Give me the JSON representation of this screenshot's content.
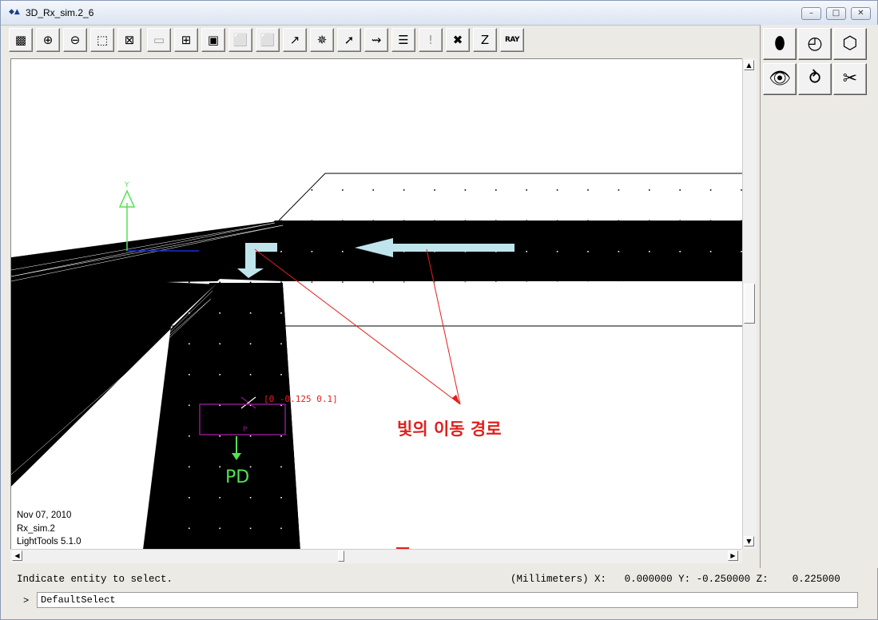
{
  "window": {
    "title": "3D_Rx_sim.2_6",
    "app_icon_text": "◆▲"
  },
  "window_controls": {
    "minimize": "–",
    "maximize": "□",
    "close": "✕"
  },
  "toolbar": {
    "buttons": [
      {
        "name": "zoom-fit-icon",
        "glyph": "▩"
      },
      {
        "name": "zoom-in-icon",
        "glyph": "⊕"
      },
      {
        "name": "zoom-out-icon",
        "glyph": "⊖"
      },
      {
        "name": "zoom-window-icon",
        "glyph": "⬚"
      },
      {
        "name": "zoom-extents-icon",
        "glyph": "⊠"
      },
      {
        "name": "blank-view-icon",
        "glyph": "▭"
      },
      {
        "name": "four-view-icon",
        "glyph": "⊞"
      },
      {
        "name": "shaded-cube-icon",
        "glyph": "▣"
      },
      {
        "name": "front-cube-icon",
        "glyph": "⬜"
      },
      {
        "name": "side-cube-icon",
        "glyph": "⬜"
      },
      {
        "name": "axes-icon",
        "glyph": "↗"
      },
      {
        "name": "rotate-axes-icon",
        "glyph": "✵"
      },
      {
        "name": "arrow-icon",
        "glyph": "➚"
      },
      {
        "name": "ray-icon",
        "glyph": "⇝"
      },
      {
        "name": "list-icon",
        "glyph": "☰"
      },
      {
        "name": "warning-icon",
        "glyph": "!"
      },
      {
        "name": "delete-icon",
        "glyph": "✖"
      },
      {
        "name": "z-icon",
        "glyph": "Z"
      },
      {
        "name": "ray-trace-icon",
        "glyph": "RAY"
      }
    ]
  },
  "right_panel": {
    "buttons": [
      {
        "name": "lens-icon",
        "glyph": "⬮"
      },
      {
        "name": "shapes-icon",
        "glyph": "◴"
      },
      {
        "name": "solids-icon",
        "glyph": "⬡"
      },
      {
        "name": "eye-icon",
        "glyph": "👁"
      },
      {
        "name": "lens-ray-icon",
        "glyph": "⥁"
      },
      {
        "name": "scissors-icon",
        "glyph": "✂"
      }
    ]
  },
  "viewport": {
    "date": "Nov 07, 2010",
    "model": "Rx_sim.2",
    "software": "LightTools 5.1.0",
    "axis_y_label": "Y",
    "coord_label": "[0 -0.125 0.1]",
    "annotation_korean": "빛의 이동 경로",
    "annotation_pd": "PD",
    "pd_marker": "P",
    "colors": {
      "arrow": "#bfe4ec",
      "red_line": "#e0201c",
      "axis_green": "#55e055",
      "pd_purple": "#8b1a8b"
    }
  },
  "status": {
    "message": "Indicate entity to select.",
    "units_label": "(Millimeters)",
    "x_label": "X:",
    "x_value": "0.000000",
    "y_label": "Y:",
    "y_value": "-0.250000",
    "z_label": "Z:",
    "z_value": "0.225000"
  },
  "command": {
    "prompt": ">",
    "value": "DefaultSelect"
  }
}
